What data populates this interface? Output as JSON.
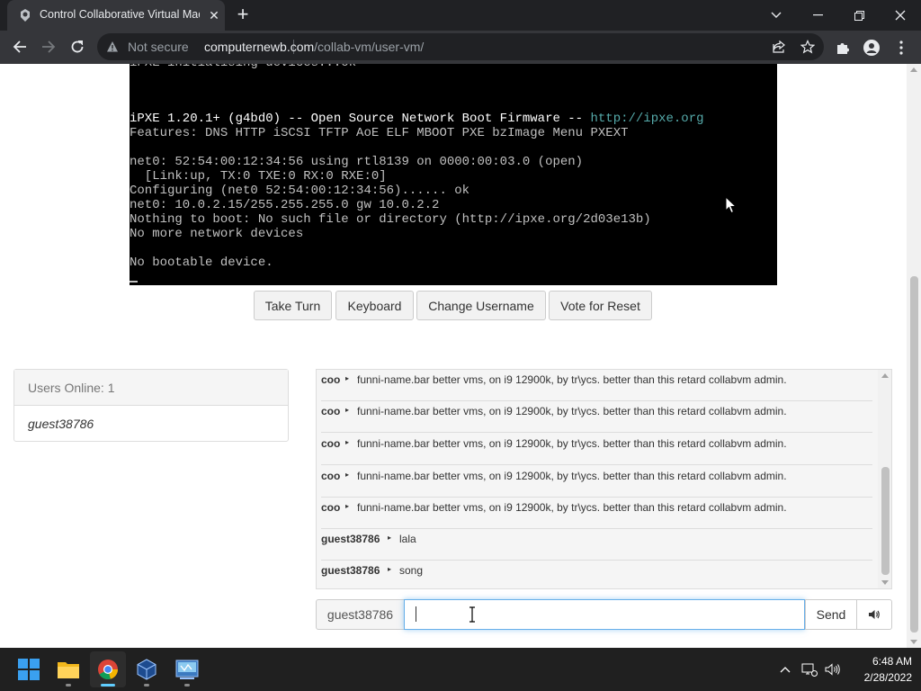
{
  "browser": {
    "tab_title": "Control Collaborative Virtual Mac",
    "security_label": "Not secure",
    "url_host": "computernewb.com",
    "url_path": "/collab-vm/user-vm/"
  },
  "vm_screen": {
    "lines": [
      {
        "text": "iPXE 1.20.1+ (g4bd0) -- Open Source Network Boot Firmware -- ",
        "link": "http://ipxe.org"
      },
      {
        "text": "Features: DNS HTTP iSCSI TFTP AoE ELF MBOOT PXE bzImage Menu PXEXT"
      },
      {
        "text": ""
      },
      {
        "text": "net0: 52:54:00:12:34:56 using rtl8139 on 0000:00:03.0 (open)"
      },
      {
        "text": "  [Link:up, TX:0 TXE:0 RX:0 RXE:0]"
      },
      {
        "text": "Configuring (net0 52:54:00:12:34:56)...... ok"
      },
      {
        "text": "net0: 10.0.2.15/255.255.255.0 gw 10.0.2.2"
      },
      {
        "text": "Nothing to boot: No such file or directory (http://ipxe.org/2d03e13b)"
      },
      {
        "text": "No more network devices"
      },
      {
        "text": ""
      },
      {
        "text": "No bootable device."
      }
    ]
  },
  "vm_buttons": {
    "take_turn": "Take Turn",
    "keyboard": "Keyboard",
    "change_username": "Change Username",
    "vote_reset": "Vote for Reset"
  },
  "users": {
    "header": "Users Online: 1",
    "list": [
      "guest38786"
    ]
  },
  "chat": {
    "messages": [
      {
        "user": "coo",
        "text": "funni-name.bar better vms, on i9 12900k, by tr\\ycs. better than this retard collabvm admin."
      },
      {
        "user": "coo",
        "text": "funni-name.bar better vms, on i9 12900k, by tr\\ycs. better than this retard collabvm admin."
      },
      {
        "user": "coo",
        "text": "funni-name.bar better vms, on i9 12900k, by tr\\ycs. better than this retard collabvm admin."
      },
      {
        "user": "coo",
        "text": "funni-name.bar better vms, on i9 12900k, by tr\\ycs. better than this retard collabvm admin."
      },
      {
        "user": "coo",
        "text": "funni-name.bar better vms, on i9 12900k, by tr\\ycs. better than this retard collabvm admin."
      },
      {
        "user": "guest38786",
        "text": "lala"
      },
      {
        "user": "guest38786",
        "text": "song"
      }
    ],
    "username": "guest38786",
    "input_value": "",
    "send_label": "Send"
  },
  "taskbar": {
    "apps": [
      "start-icon",
      "file-explorer-icon",
      "chrome-icon",
      "virtualbox-icon",
      "vista-app-icon"
    ],
    "time": "6:48 AM",
    "date": "2/28/2022"
  }
}
